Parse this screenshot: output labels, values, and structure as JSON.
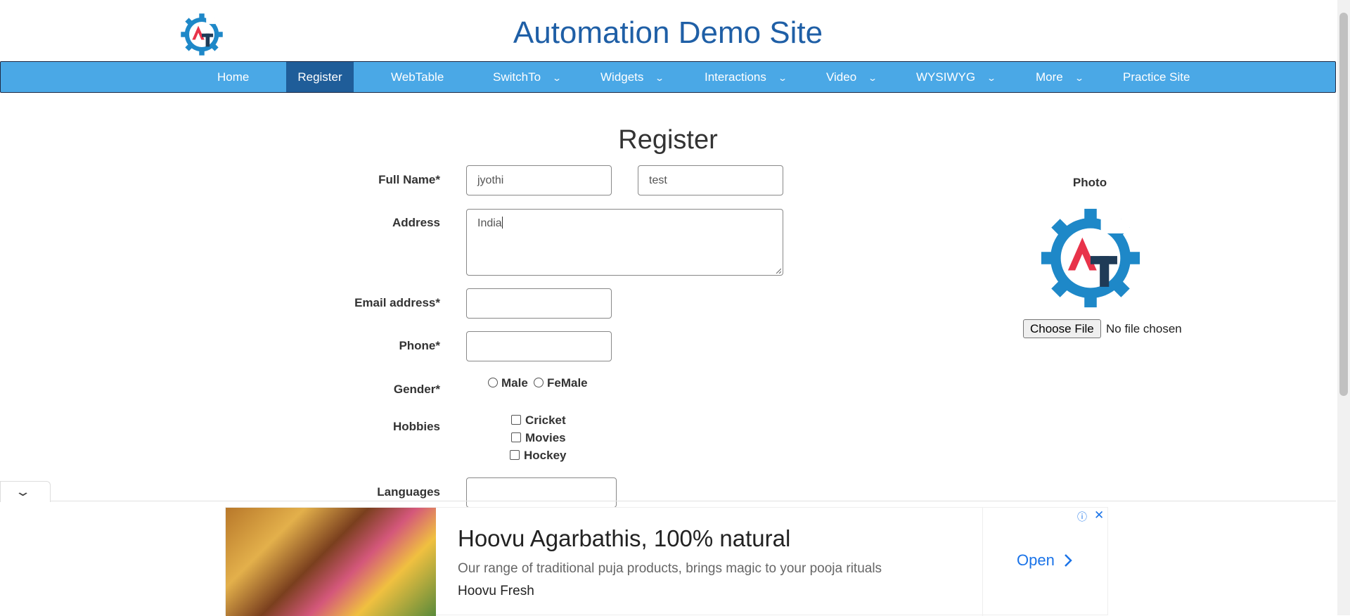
{
  "header": {
    "site_title": "Automation Demo Site",
    "logo_icon": "automation-testing-gear-logo"
  },
  "nav": {
    "items": [
      {
        "label": "Home",
        "caret": ""
      },
      {
        "label": "Register",
        "caret": ""
      },
      {
        "label": "WebTable",
        "caret": ""
      },
      {
        "label": "SwitchTo",
        "caret": "⌄"
      },
      {
        "label": "Widgets",
        "caret": "⌄"
      },
      {
        "label": "Interactions",
        "caret": "⌄"
      },
      {
        "label": "Video",
        "caret": "⌄"
      },
      {
        "label": "WYSIWYG",
        "caret": "⌄"
      },
      {
        "label": "More",
        "caret": "⌄"
      },
      {
        "label": "Practice Site",
        "caret": ""
      }
    ],
    "active": "Register",
    "bg_color": "#4aa8e6",
    "active_color": "#1f5d99"
  },
  "form": {
    "heading": "Register",
    "full_name_label": "Full Name*",
    "first_name_value": "jyothi",
    "last_name_value": "test",
    "address_label": "Address",
    "address_value": "India",
    "email_label": "Email address*",
    "email_value": "",
    "phone_label": "Phone*",
    "phone_value": "",
    "gender_label": "Gender*",
    "gender_options": [
      "Male",
      "FeMale"
    ],
    "hobbies_label": "Hobbies",
    "hobbies_options": [
      "Cricket",
      "Movies",
      "Hockey"
    ],
    "languages_label": "Languages",
    "languages_value": ""
  },
  "photo": {
    "label": "Photo",
    "choose_button": "Choose File",
    "file_status": "No file chosen"
  },
  "ad": {
    "headline": "Hoovu Agarbathis, 100% natural",
    "description": "Our range of traditional puja products, brings magic to your pooja rituals",
    "brand": "Hoovu Fresh",
    "cta": "Open",
    "cta_icon": "chevron-right-icon",
    "info_icon": "ⓘ",
    "close_icon": "✕",
    "collapse_icon": "⌄"
  }
}
